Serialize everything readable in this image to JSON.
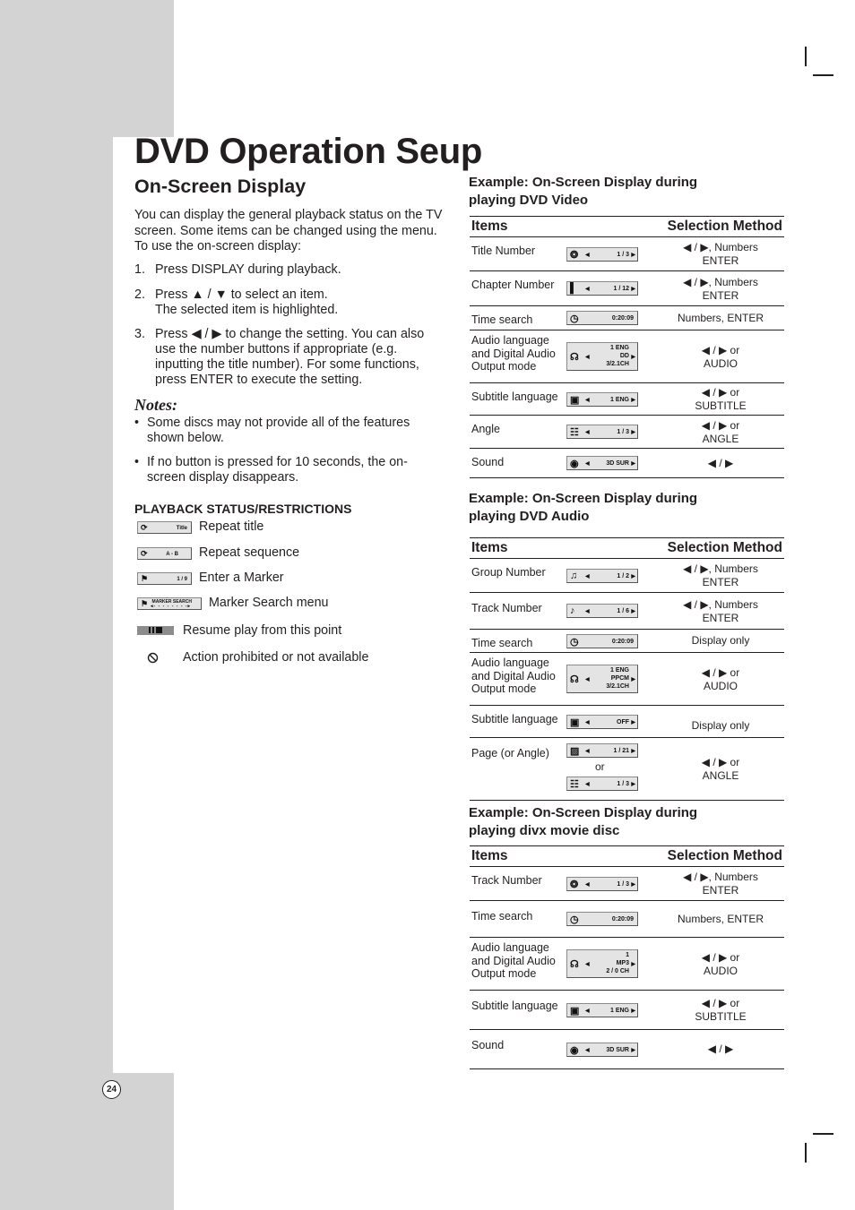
{
  "page": {
    "title": "DVD Operation Seup",
    "section_title": "On-Screen Display",
    "page_number": "24"
  },
  "intro": {
    "lines": [
      "You can display the general playback status on the TV",
      "screen. Some items can be changed using the menu.",
      "To use the on-screen display:"
    ],
    "steps": [
      {
        "num": "1.",
        "lines": [
          "Press DISPLAY during playback."
        ]
      },
      {
        "num": "2.",
        "lines": [
          "Press ▲ / ▼ to select an item.",
          "The selected item is highlighted."
        ]
      },
      {
        "num": "3.",
        "lines": [
          "Press ◀ / ▶ to change the setting. You can also",
          "use the number buttons if appropriate (e.g.",
          "inputting the title number). For some functions,",
          "press ENTER to execute the setting."
        ]
      }
    ]
  },
  "notes": {
    "title": "Notes:",
    "bullet": "•",
    "items": [
      {
        "lines": [
          "Some discs may not provide all of the features",
          "shown below."
        ]
      },
      {
        "lines": [
          "If no button is pressed for 10 seconds, the on-",
          "screen display disappears."
        ]
      }
    ]
  },
  "playback_status": {
    "heading": "PLAYBACK STATUS/RESTRICTIONS",
    "items": [
      {
        "icon": "repeat-icon",
        "osd": "Title",
        "label": "Repeat title"
      },
      {
        "icon": "repeat-icon",
        "osd": "A - B",
        "label": "Repeat sequence"
      },
      {
        "icon": "marker-icon",
        "osd": "1 / 9",
        "label": "Enter a Marker"
      },
      {
        "icon": "marker-icon",
        "osd": "MARKER SEARCH",
        "label": "Marker Search menu"
      },
      {
        "icon": "resume-icon",
        "osd": "❚❚ ■",
        "label": "Resume play from this point"
      },
      {
        "icon": "prohibited-icon",
        "osd": "⃠",
        "label": "Action prohibited or not available"
      }
    ]
  },
  "tables": [
    {
      "title_lines": [
        "Example: On-Screen Display during",
        "playing DVD Video"
      ],
      "headers": {
        "items": "Items",
        "method": "Selection Method"
      },
      "rows": [
        {
          "item": [
            "Title Number"
          ],
          "icon": "title-disc-icon",
          "osd": [
            "1 / 3"
          ],
          "arrows": true,
          "method": [
            "◀ / ▶, Numbers",
            "ENTER"
          ]
        },
        {
          "item": [
            "Chapter Number"
          ],
          "icon": "chapter-film-icon",
          "osd": [
            "1 / 12"
          ],
          "arrows": true,
          "method": [
            "◀ / ▶, Numbers",
            "ENTER"
          ]
        },
        {
          "item": [
            "Time search"
          ],
          "icon": "clock-icon",
          "osd": [
            "0:20:09"
          ],
          "arrows": false,
          "method": [
            "Numbers, ENTER"
          ]
        },
        {
          "item": [
            "Audio language",
            "and Digital Audio",
            "Output mode"
          ],
          "icon": "headphones-icon",
          "osd": [
            "1 ENG",
            "DD",
            "3/2.1CH"
          ],
          "arrows": true,
          "method": [
            "◀ / ▶ or",
            "AUDIO"
          ]
        },
        {
          "item": [
            "Subtitle language"
          ],
          "icon": "subtitle-icon",
          "osd": [
            "1 ENG"
          ],
          "arrows": true,
          "method": [
            "◀ / ▶ or",
            "SUBTITLE"
          ]
        },
        {
          "item": [
            "Angle"
          ],
          "icon": "angle-camera-icon",
          "osd": [
            "1 / 3"
          ],
          "arrows": true,
          "method": [
            "◀ / ▶ or",
            "ANGLE"
          ]
        },
        {
          "item": [
            "Sound"
          ],
          "icon": "sound-speaker-icon",
          "osd": [
            "3D SUR"
          ],
          "arrows": true,
          "method": [
            "◀ / ▶"
          ]
        }
      ]
    },
    {
      "title_lines": [
        "Example: On-Screen Display during",
        "playing DVD Audio"
      ],
      "headers": {
        "items": "Items",
        "method": "Selection Method"
      },
      "rows": [
        {
          "item": [
            "Group Number"
          ],
          "icon": "group-folder-icon",
          "osd": [
            "1 / 2"
          ],
          "arrows": true,
          "method": [
            "◀ / ▶, Numbers",
            "ENTER"
          ]
        },
        {
          "item": [
            "Track Number"
          ],
          "icon": "track-note-icon",
          "osd": [
            "1 / 6"
          ],
          "arrows": true,
          "method": [
            "◀ / ▶, Numbers",
            "ENTER"
          ]
        },
        {
          "item": [
            "Time search"
          ],
          "icon": "clock-icon",
          "osd": [
            "0:20:09"
          ],
          "arrows": false,
          "method": [
            "Display only"
          ]
        },
        {
          "item": [
            "Audio language",
            "and Digital Audio",
            "Output mode"
          ],
          "icon": "headphones-icon",
          "osd": [
            "1 ENG",
            "PPCM",
            "3/2.1CH"
          ],
          "arrows": true,
          "method": [
            "◀ / ▶ or",
            "AUDIO"
          ]
        },
        {
          "item": [
            "Subtitle language"
          ],
          "icon": "subtitle-icon",
          "osd": [
            "OFF"
          ],
          "arrows": true,
          "method": [
            "Display only"
          ]
        },
        {
          "item": [
            "Page (or Angle)"
          ],
          "icon": "page-picture-icon",
          "osd": [
            "1 / 21"
          ],
          "arrows": true,
          "or_text": "or",
          "osd2": {
            "icon": "angle-camera-icon",
            "value": "1 / 3"
          },
          "method": [
            "◀ / ▶ or",
            "ANGLE"
          ]
        }
      ]
    },
    {
      "title_lines": [
        "Example: On-Screen Display during",
        "playing divx movie disc"
      ],
      "headers": {
        "items": "Items",
        "method": "Selection Method"
      },
      "rows": [
        {
          "item": [
            "Track Number"
          ],
          "icon": "title-disc-icon",
          "osd": [
            "1 / 3"
          ],
          "arrows": true,
          "method": [
            "◀ / ▶, Numbers",
            "ENTER"
          ]
        },
        {
          "item": [
            "Time search"
          ],
          "icon": "clock-icon",
          "osd": [
            "0:20:09"
          ],
          "arrows": false,
          "method": [
            "Numbers, ENTER"
          ]
        },
        {
          "item": [
            "Audio language",
            "and Digital Audio",
            "Output mode"
          ],
          "icon": "headphones-icon",
          "osd": [
            "1",
            "MP3",
            "2 / 0 CH"
          ],
          "arrows": true,
          "method": [
            "◀ / ▶ or",
            "AUDIO"
          ]
        },
        {
          "item": [
            "Subtitle language"
          ],
          "icon": "subtitle-icon",
          "osd": [
            "1 ENG"
          ],
          "arrows": true,
          "method": [
            "◀ / ▶ or",
            "SUBTITLE"
          ]
        },
        {
          "item": [
            "Sound"
          ],
          "icon": "sound-speaker-icon",
          "osd": [
            "3D SUR"
          ],
          "arrows": true,
          "method": [
            "◀ / ▶"
          ]
        }
      ]
    }
  ]
}
